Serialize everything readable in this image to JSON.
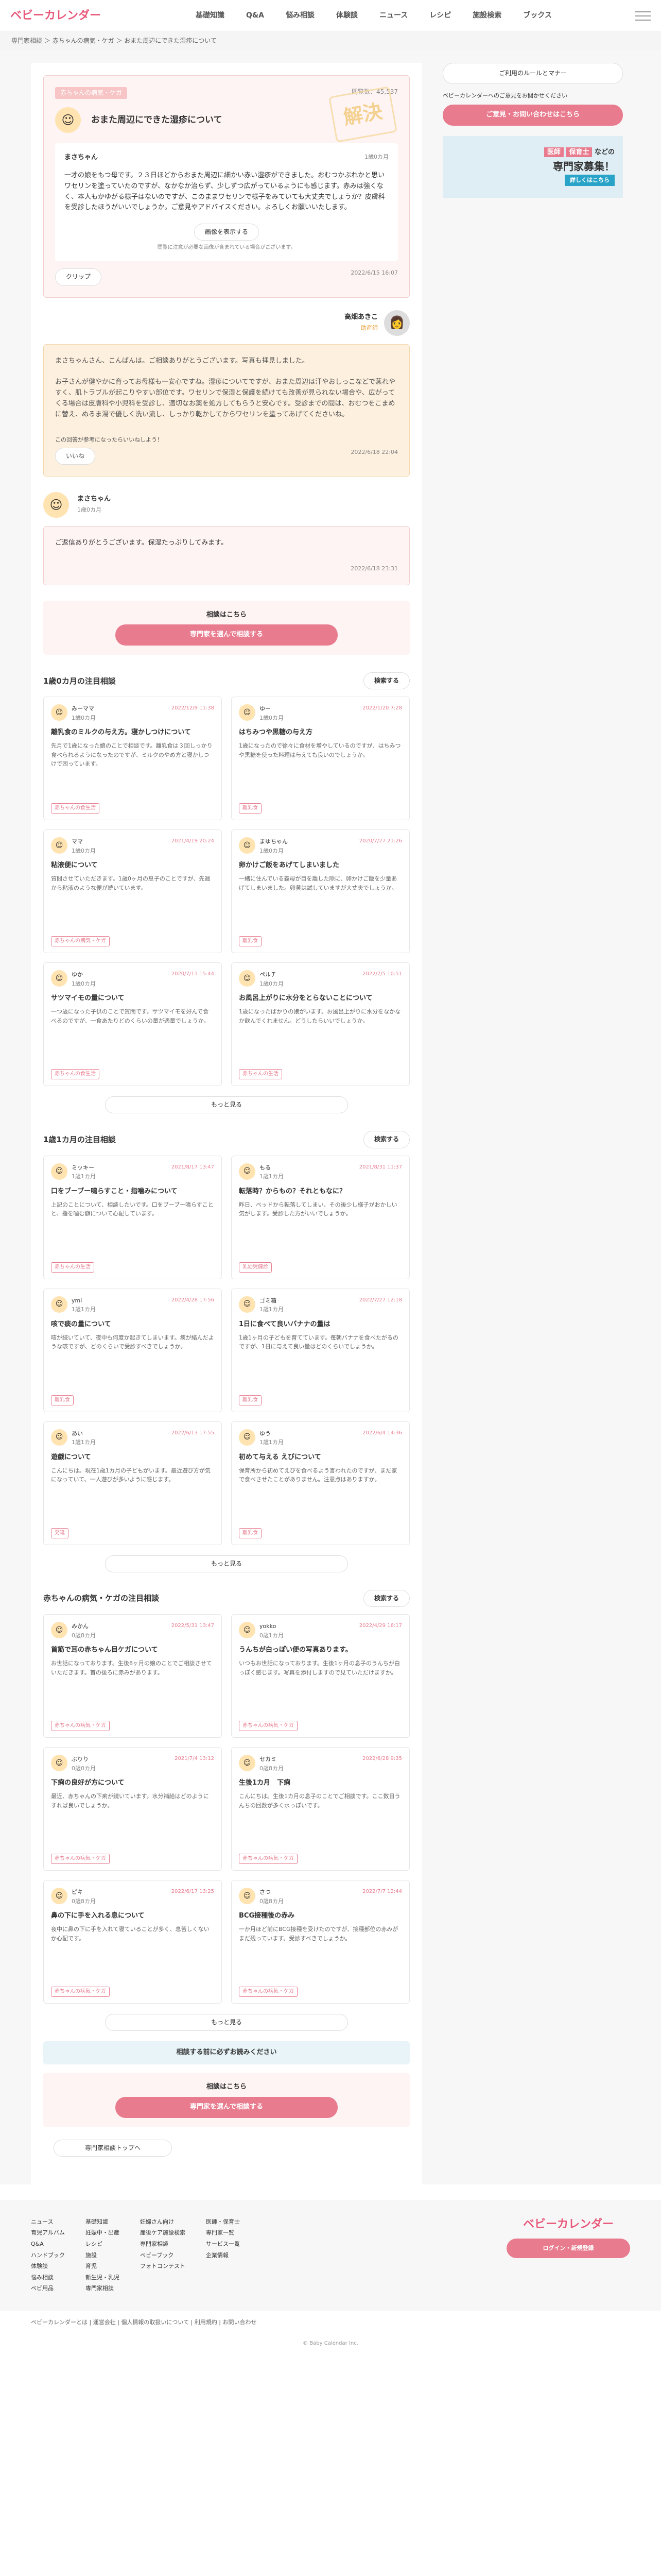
{
  "logo": "ベビーカレンダー",
  "nav": [
    "基礎知識",
    "Q&A",
    "悩み相談",
    "体験談",
    "ニュース",
    "レシピ",
    "施設検索",
    "ブックス"
  ],
  "crumb": "専門家相談 ＞ 赤ちゃんの病気・ケガ ＞ おまた周辺にできた湿疹について",
  "q": {
    "tag": "赤ちゃんの病気・ケガ",
    "views": "閲覧数：45,537",
    "stamp": "解決",
    "title": "おまた周辺にできた湿疹について",
    "user": "まさちゃん",
    "age": "1歳0カ月",
    "body": "一才の娘をもつ母です。２３日ほどからおまた周辺に細かい赤い湿疹ができました。おむつかぶれかと思いワセリンを塗っていたのですが、なかなか治らず、少しずつ広がっているようにも感じます。赤みは強くなく、本人もかゆがる様子はないのですが、このままワセリンで様子をみていても大丈夫でしょうか？皮膚科を受診したほうがいいでしょうか。ご意見やアドバイスください。よろしくお願いいたします。",
    "img_btn": "画像を表示する",
    "img_note": "閲覧に注意が必要な画像が含まれている場合がございます。",
    "clip": "クリップ",
    "date": "2022/6/15 16:07"
  },
  "answer": {
    "name": "高畑あきこ",
    "role": "助産師",
    "body": "まさちゃんさん、こんばんは。ご相談ありがとうございます。写真も拝見しました。\n\nお子さんが健やかに育ってお母様も一安心ですね。湿疹についてですが、おまた周辺は汗やおしっこなどで蒸れやすく、肌トラブルが起こりやすい部位です。ワセリンで保湿と保護を続けても改善が見られない場合や、広がってくる場合は皮膚科や小児科を受診し、適切なお薬を処方してもらうと安心です。受診までの間は、おむつをこまめに替え、ぬるま湯で優しく洗い流し、しっかり乾かしてからワセリンを塗ってあげてくださいね。",
    "helpful": "この回答が参考になったらいいねしよう！",
    "like": "いいね",
    "date": "2022/6/18 22:04"
  },
  "reply": {
    "user": "まさちゃん",
    "age": "1歳0カ月",
    "body": "ご返信ありがとうございます。保湿たっぷりしてみます。",
    "date": "2022/6/18 23:31"
  },
  "cta": {
    "label": "相談はこちら",
    "btn": "専門家を選んで相談する"
  },
  "sections": [
    {
      "title": "1歳0カ月の注目相談",
      "search": "検索する",
      "cards": [
        {
          "user": "みーママ",
          "age": "1歳0カ月",
          "date": "2022/12/9 11:38",
          "t": "離乳食のミルクの与え方。寝かしつけについて",
          "b": "先月で1歳になった娘のことで相談です。離乳食は３回しっかり食べられるようになったのですが、ミルクのやめ方と寝かしつけで困っています。",
          "lbl": "赤ちゃんの食生活"
        },
        {
          "user": "ゆー",
          "age": "1歳0カ月",
          "date": "2022/1/20 7:28",
          "t": "はちみつや黒糖の与え方",
          "b": "1歳になったので徐々に食材を増やしているのですが、はちみつや黒糖を使った料理は与えても良いのでしょうか。",
          "lbl": "離乳食"
        },
        {
          "user": "ママ",
          "age": "1歳0カ月",
          "date": "2021/4/19 20:24",
          "t": "粘液便について",
          "b": "質問させていただきます。1歳0ヶ月の息子のことですが、先週から粘液のような便が続いています。",
          "lbl": "赤ちゃんの病気・ケガ"
        },
        {
          "user": "まゆちゃん",
          "age": "1歳0カ月",
          "date": "2020/7/27 21:26",
          "t": "卵かけご飯をあげてしまいました",
          "b": "一緒に住んでいる義母が目を離した隙に、卵かけご飯を少量あげてしまいました。卵黄は試していますが大丈夫でしょうか。",
          "lbl": "離乳食"
        },
        {
          "user": "ゆか",
          "age": "1歳0カ月",
          "date": "2020/7/11 15:44",
          "t": "サツマイモの量について",
          "b": "一つ歳になった子供のことで質問です。サツマイモを好んで食べるのですが、一食あたりどのくらいの量が適量でしょうか。",
          "lbl": "赤ちゃんの食生活"
        },
        {
          "user": "ペルチ",
          "age": "1歳0カ月",
          "date": "2022/7/5 10:51",
          "t": "お風呂上がりに水分をとらないことについて",
          "b": "1歳になったばかりの娘がいます。お風呂上がりに水分をなかなか飲んでくれません。どうしたらいいでしょうか。",
          "lbl": "赤ちゃんの生活"
        }
      ]
    },
    {
      "title": "1歳1カ月の注目相談",
      "search": "検索する",
      "cards": [
        {
          "user": "ミッキー",
          "age": "1歳1カ月",
          "date": "2021/8/17 13:47",
          "t": "口をブーブー鳴らすこと・指噛みについて",
          "b": "上記のことについて、相談したいです。口をブーブー鳴らすことと、指を噛む癖について心配しています。",
          "lbl": "赤ちゃんの生活"
        },
        {
          "user": "もる",
          "age": "1歳1カ月",
          "date": "2021/8/31 11:37",
          "t": "転落時？からもの？それともなに？",
          "b": "昨日、ベッドから転落してしまい、その後少し様子がおかしい気がします。受診した方がいいでしょうか。",
          "lbl": "乳幼児健診"
        },
        {
          "user": "ymi",
          "age": "1歳1カ月",
          "date": "2022/4/28 17:56",
          "t": "咳で痰の量について",
          "b": "咳が続いていて、夜中も何度か起きてしまいます。痰が絡んだような咳ですが、どのくらいで受診すべきでしょうか。",
          "lbl": "離乳食"
        },
        {
          "user": "ゴミ箱",
          "age": "1歳1カ月",
          "date": "2022/7/27 12:18",
          "t": "1日に食べて良いバナナの量は",
          "b": "1歳1ヶ月の子どもを育てています。毎朝バナナを食べたがるのですが、1日に与えて良い量はどのくらいでしょうか。",
          "lbl": "離乳食"
        },
        {
          "user": "あい",
          "age": "1歳1カ月",
          "date": "2022/6/13 17:55",
          "t": "遊戯について",
          "b": "こんにちは。現在1歳1カ月の子どもがいます。最近遊び方が気になっていて、一人遊びが多いように感じます。",
          "lbl": "発達"
        },
        {
          "user": "ゆう",
          "age": "1歳1カ月",
          "date": "2022/6/4 14:36",
          "t": "初めて与える えびについて",
          "b": "保育所から初めてえびを食べるよう言われたのですが、まだ家で食べさせたことがありません。注意点はありますか。",
          "lbl": "離乳食"
        }
      ]
    },
    {
      "title": "赤ちゃんの病気・ケガの注目相談",
      "search": "検索する",
      "cards": [
        {
          "user": "みかん",
          "age": "0歳8カ月",
          "date": "2022/5/31 13:47",
          "t": "首筋で耳の赤ちゃん目ケガについて",
          "b": "お世話になっております。生後8ヶ月の娘のことでご相談させていただきます。首の後ろに赤みがあります。",
          "lbl": "赤ちゃんの病気・ケガ"
        },
        {
          "user": "yokko",
          "age": "0歳1カ月",
          "date": "2022/4/29 16:17",
          "t": "うんちが白っぽい便の写真あります。",
          "b": "いつもお世話になっております。生後1ヶ月の息子のうんちが白っぽく感じます。写真を添付しますので見ていただけますか。",
          "lbl": "赤ちゃんの病気・ケガ"
        },
        {
          "user": "ぶりり",
          "age": "0歳0カ月",
          "date": "2021/7/4 13:12",
          "t": "下痢の良好が方について",
          "b": "最近、赤ちゃんの下痢が続いています。水分補給はどのようにすれば良いでしょうか。",
          "lbl": "赤ちゃんの病気・ケガ"
        },
        {
          "user": "セカミ",
          "age": "0歳8カ月",
          "date": "2022/6/28 9:35",
          "t": "生後1カ月　下痢",
          "b": "こんにちは。生後1カ月の息子のことでご相談です。ここ数日うんちの回数が多く水っぽいです。",
          "lbl": "赤ちゃんの病気・ケガ"
        },
        {
          "user": "ピキ",
          "age": "0歳8カ月",
          "date": "2022/6/17 13:25",
          "t": "鼻の下に手を入れる息について",
          "b": "夜中に鼻の下に手を入れて寝ていることが多く、息苦しくないか心配です。",
          "lbl": "赤ちゃんの病気・ケガ"
        },
        {
          "user": "さつ",
          "age": "0歳8カ月",
          "date": "2022/7/7 12:44",
          "t": "BCG接種後の赤み",
          "b": "一か月ほど前にBCG接種を受けたのですが、接種部位の赤みがまだ残っています。受診すべきでしょうか。",
          "lbl": "赤ちゃんの病気・ケガ"
        }
      ]
    }
  ],
  "more": "もっと見る",
  "read_banner": "相談する前に必ずお読みください",
  "back": "専門家相談トップへ",
  "side": {
    "rules": "ご利用のルールとマナー",
    "notice": "ベビーカレンダーへのご意見をお聞かせください",
    "contact": "ご意見・お問い合わせはこちら",
    "ad1": "医師",
    "ad2": "保育士",
    "ad3": "などの",
    "ad4": "専門家募集！",
    "ad5": "詳しくはこちら"
  },
  "footer": {
    "col1": [
      "ニュース",
      "育児アルバム",
      "Q&A",
      "ハンドブック",
      "体験談",
      "悩み相談",
      "ベビ用品"
    ],
    "col2": [
      "基礎知識",
      "妊娠中・出産",
      "レシピ",
      "施設",
      "育児",
      "新生児・乳児",
      "専門家相談"
    ],
    "col3": [
      "妊婦さん向け",
      "産後ケア施設検索",
      "専門家相談",
      "ベビーブック",
      "フォトコンテスト"
    ],
    "col4": [
      "医師・保育士",
      "専門家一覧",
      "サービス一覧",
      "企業情報"
    ],
    "logo": "ベビーカレンダー",
    "login": "ログイン・新規登録",
    "links": "ベビーカレンダーとは | 運営会社 | 個人情報の取扱いについて | 利用規約 | お問い合わせ",
    "copy": "© Baby Calendar Inc."
  }
}
